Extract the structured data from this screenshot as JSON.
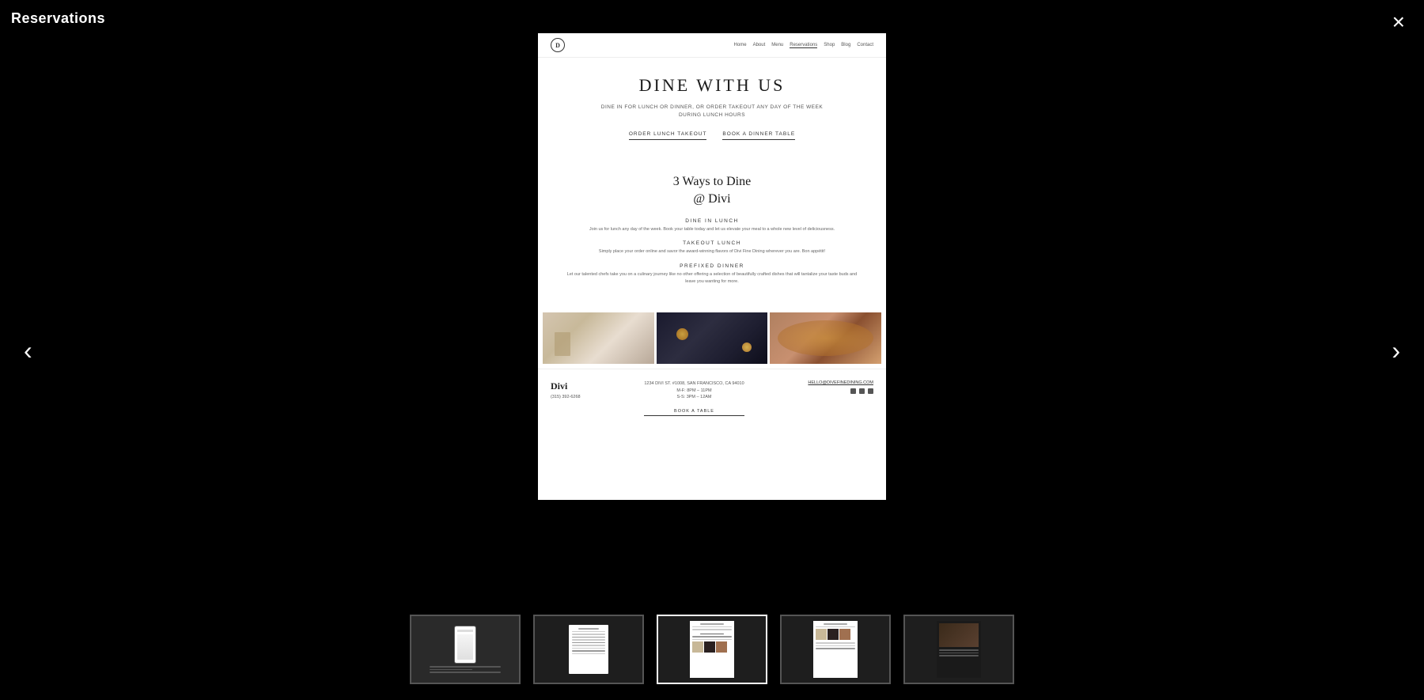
{
  "title": "Reservations",
  "close_button": "×",
  "prev_arrow": "‹",
  "next_arrow": "›",
  "website": {
    "nav": {
      "logo_letter": "D",
      "links": [
        "Home",
        "About",
        "Menu",
        "Reservations",
        "Shop",
        "Blog",
        "Contact"
      ]
    },
    "hero": {
      "title": "DINE WITH US",
      "subtitle_line1": "DINE IN FOR LUNCH OR DINNER, OR ORDER TAKEOUT ANY DAY OF THE WEEK",
      "subtitle_line2": "DURING LUNCH HOURS"
    },
    "cta": {
      "btn1": "ORDER LUNCH TAKEOUT",
      "btn2": "BOOK A DINNER TABLE"
    },
    "ways": {
      "title_line1": "3 Ways to Dine",
      "title_line2": "@ Divi",
      "items": [
        {
          "heading": "DINE IN LUNCH",
          "text": "Join us for lunch any day of the week. Book your table today and let us elevate your meal to a whole new level of deliciousness."
        },
        {
          "heading": "TAKEOUT LUNCH",
          "text": "Simply place your order online and savor the award-winning flavors of Divi Fine Dining wherever you are. Bon appétit!"
        },
        {
          "heading": "PREFIXED DINNER",
          "text": "Let our talented chefs take you on a culinary journey like no other offering a selection of beautifully crafted dishes that will tantalize your taste buds and leave you wanting for more."
        }
      ]
    },
    "footer": {
      "brand": "Divi",
      "phone": "(315) 392-6268",
      "address_line1": "1234 DIVI ST. #1008, SAN FRANCISCO, CA 94010",
      "hours_line1": "M-F: 8PM – 11PM",
      "hours_line2": "S-S: 3PM – 12AM",
      "email": "HELLO@DIVEFINEDINING.COM",
      "book_btn": "BOOK A TABLE"
    }
  },
  "thumbnails": [
    {
      "id": 1,
      "label": "thumb-1",
      "active": false
    },
    {
      "id": 2,
      "label": "thumb-2",
      "active": false
    },
    {
      "id": 3,
      "label": "thumb-3",
      "active": true
    },
    {
      "id": 4,
      "label": "thumb-4",
      "active": false
    },
    {
      "id": 5,
      "label": "thumb-5",
      "active": false
    }
  ]
}
